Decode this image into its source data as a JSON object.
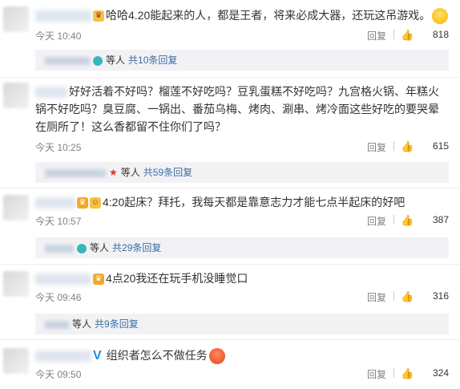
{
  "comments": [
    {
      "text": "哈哈4.20能起来的人，都是王者，将来必成大器，还玩这吊游戏。",
      "time": "今天 10:40",
      "reply_label": "回复",
      "likes": "818",
      "emoji": "laughing-face",
      "replies": {
        "suffix": "等人",
        "count": "共10条回复"
      }
    },
    {
      "text": "好好活着不好吗？榴莲不好吃吗？豆乳蛋糕不好吃吗？九宫格火锅、年糕火锅不好吃吗？臭豆腐、一锅出、番茄乌梅、烤肉、涮串、烤冷面这些好吃的要哭晕在厕所了！这么香都留不住你们了吗？",
      "time": "今天 10:25",
      "reply_label": "回复",
      "likes": "615",
      "replies": {
        "suffix": "等人",
        "count": "共59条回复"
      }
    },
    {
      "text": "4:20起床？拜托，我每天都是靠意志力才能七点半起床的好吧",
      "time": "今天 10:57",
      "reply_label": "回复",
      "likes": "387",
      "replies": {
        "suffix": "等人",
        "count": "共29条回复"
      }
    },
    {
      "text": "4点20我还在玩手机没睡觉口",
      "time": "今天 09:46",
      "reply_label": "回复",
      "likes": "316",
      "replies": {
        "suffix": "等人",
        "count": "共9条回复"
      }
    },
    {
      "text": "组织者怎么不做任务",
      "time": "今天 09:50",
      "reply_label": "回复",
      "likes": "324",
      "emoji": "angry-face"
    }
  ],
  "icons": {
    "like": "thumbs-up-icon",
    "verified": "verified-v-icon"
  },
  "colors": {
    "link": "#3a6ea5",
    "muted": "#808080",
    "reply_bg": "#f2f2f5"
  }
}
